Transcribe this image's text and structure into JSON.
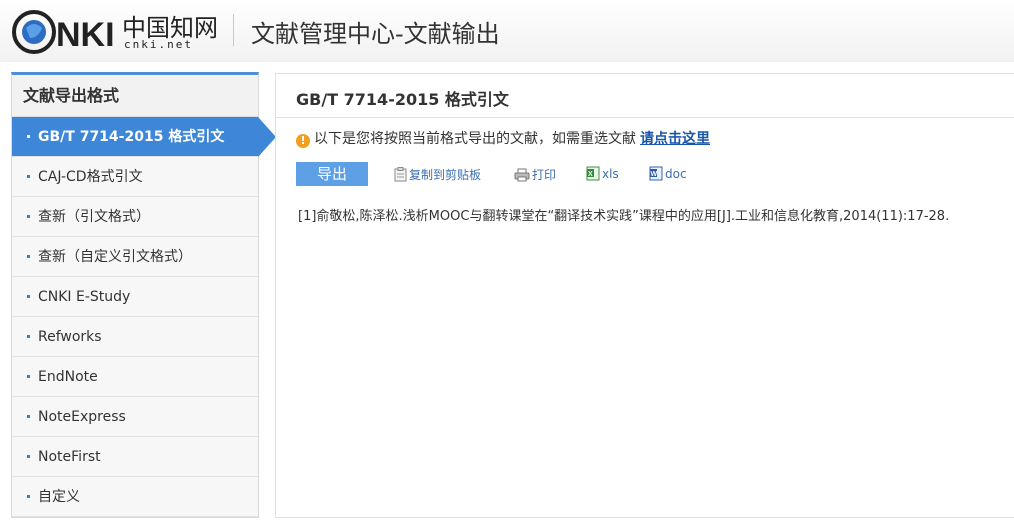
{
  "header": {
    "logo_text": "CNKI中国知网",
    "logo_sub": "cnki.net",
    "title": "文献管理中心-文献输出"
  },
  "sidebar": {
    "title": "文献导出格式",
    "items": [
      {
        "label": "GB/T 7714-2015 格式引文",
        "active": true
      },
      {
        "label": "CAJ-CD格式引文"
      },
      {
        "label": "查新（引文格式）"
      },
      {
        "label": "查新（自定义引文格式）"
      },
      {
        "label": "CNKI E-Study"
      },
      {
        "label": "Refworks"
      },
      {
        "label": "EndNote"
      },
      {
        "label": "NoteExpress"
      },
      {
        "label": "NoteFirst"
      },
      {
        "label": "自定义"
      }
    ]
  },
  "main": {
    "title": "GB/T 7714-2015 格式引文",
    "notice_text": "以下是您将按照当前格式导出的文献，如需重选文献",
    "notice_link": "请点击这里",
    "toolbar": {
      "export_label": "导出",
      "copy_label": "复制到剪贴板",
      "print_label": "打印",
      "xls_label": "xls",
      "doc_label": "doc"
    },
    "citation": "[1]俞敬松,陈泽松.浅析MOOC与翻转课堂在“翻译技术实践”课程中的应用[J].工业和信息化教育,2014(11):17-28."
  },
  "colors": {
    "accent": "#3d86d8",
    "export_button": "#5ea0e6",
    "link": "#1a55a8",
    "warning": "#f0a020"
  },
  "icons": {
    "warning": "warning-icon",
    "copy": "clipboard-icon",
    "print": "printer-icon",
    "xls": "excel-file-icon",
    "doc": "word-file-icon"
  }
}
